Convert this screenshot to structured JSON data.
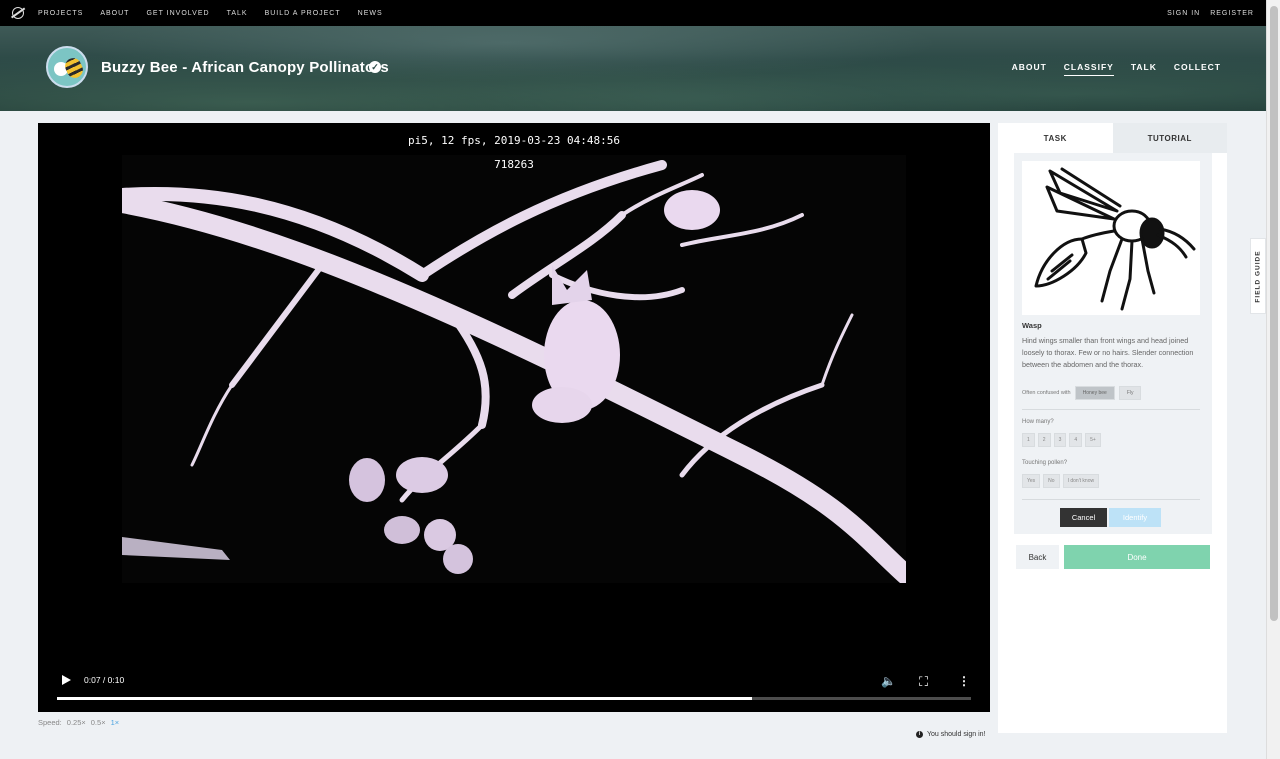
{
  "topnav": {
    "links": [
      "PROJECTS",
      "ABOUT",
      "GET INVOLVED",
      "TALK",
      "BUILD A PROJECT",
      "NEWS"
    ],
    "sign_in": "SIGN IN",
    "register": "REGISTER"
  },
  "project": {
    "title": "Buzzy Bee - African Canopy Pollinators",
    "verified_glyph": "✓",
    "nav": [
      "ABOUT",
      "CLASSIFY",
      "TALK",
      "COLLECT"
    ],
    "active_nav": "CLASSIFY"
  },
  "video": {
    "osd_line1": "pi5, 12 fps, 2019-03-23 04:48:56",
    "osd_line2": "718263",
    "time": "0:07 / 0:10",
    "progress": 0.76
  },
  "speed": {
    "label": "Speed:",
    "options": [
      "0.25×",
      "0.5×",
      "1×"
    ],
    "selected": "1×"
  },
  "signin_note": "You should sign in!",
  "panel": {
    "tabs": [
      "TASK",
      "TUTORIAL"
    ],
    "guide": {
      "name": "Wasp",
      "description": "Hind wings smaller than front wings and head joined loosely to thorax. Few or no hairs. Slender connection between the abdomen and the thorax.",
      "confused_label": "Often confused with",
      "confused_with": [
        "Honey bee",
        "Fly"
      ]
    },
    "how_many": {
      "question": "How many?",
      "options": [
        "1",
        "2",
        "3",
        "4",
        "5+"
      ]
    },
    "touching_pollen": {
      "question": "Touching pollen?",
      "options": [
        "Yes",
        "No",
        "I don't know"
      ]
    },
    "cancel": "Cancel",
    "identify": "Identify",
    "back": "Back",
    "done": "Done"
  },
  "field_guide": "FIELD GUIDE",
  "colors": {
    "accent_blue": "#4aa3df",
    "done_green": "#7fd3ae",
    "identify_blue": "#bde2f7"
  }
}
